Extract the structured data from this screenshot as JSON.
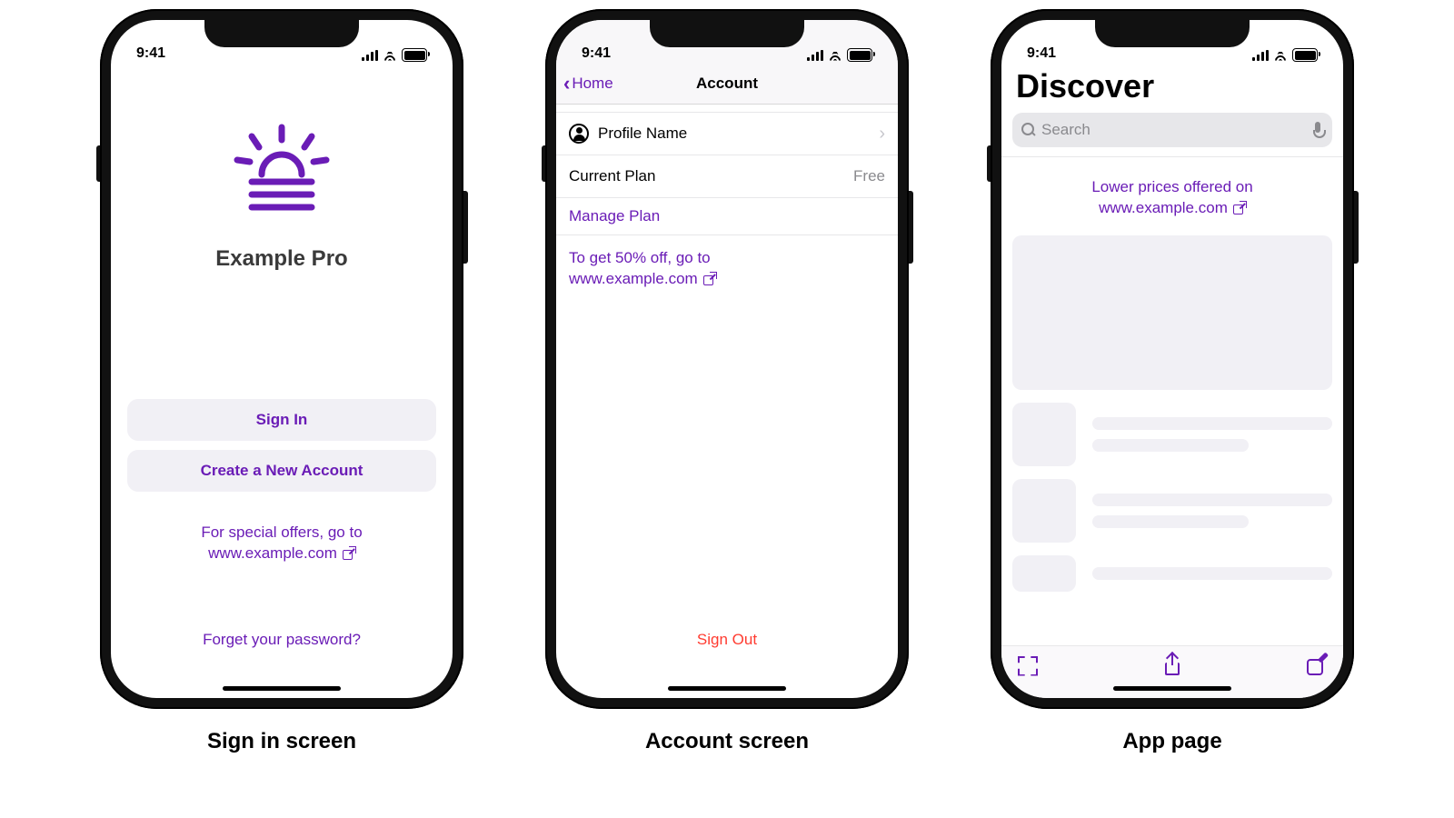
{
  "status": {
    "time": "9:41"
  },
  "screen1": {
    "caption": "Sign in screen",
    "brand": "Example Pro",
    "sign_in": "Sign In",
    "create": "Create a New Account",
    "promo_line1": "For special offers, go to",
    "promo_line2": "www.example.com",
    "forgot": "Forget your password?"
  },
  "screen2": {
    "caption": "Account screen",
    "back": "Home",
    "title": "Account",
    "profile": "Profile Name",
    "plan_label": "Current Plan",
    "plan_value": "Free",
    "manage": "Manage Plan",
    "promo_line1": "To get 50% off, go to",
    "promo_line2": "www.example.com",
    "sign_out": "Sign Out"
  },
  "screen3": {
    "caption": "App page",
    "title": "Discover",
    "search_placeholder": "Search",
    "banner_line1": "Lower prices offered on",
    "banner_line2": "www.example.com"
  }
}
